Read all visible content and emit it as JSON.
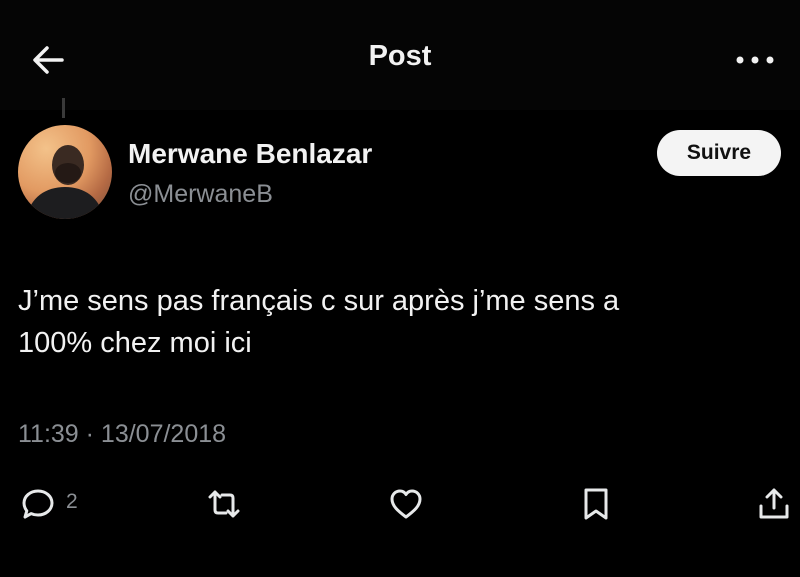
{
  "header": {
    "title": "Post",
    "back_icon": "arrow-left-icon",
    "more_icon": "more-horizontal-icon"
  },
  "author": {
    "name": "Merwane Benlazar",
    "handle": "@MerwaneB",
    "follow_label": "Suivre"
  },
  "tweet": {
    "text_line1": "J’me sens pas français c sur après j’me sens a",
    "text_line2": "100% chez moi ici",
    "meta": "11:39 · 13/07/2018"
  },
  "actions": {
    "reply_icon": "reply-icon",
    "reply_count": "2",
    "retweet_icon": "retweet-icon",
    "like_icon": "heart-icon",
    "bookmark_icon": "bookmark-icon",
    "share_icon": "share-icon"
  },
  "colors": {
    "background": "#000000",
    "primary_text": "#f2f2f2",
    "secondary_text": "#8b8f94",
    "follow_button_bg": "#f4f4f4"
  }
}
